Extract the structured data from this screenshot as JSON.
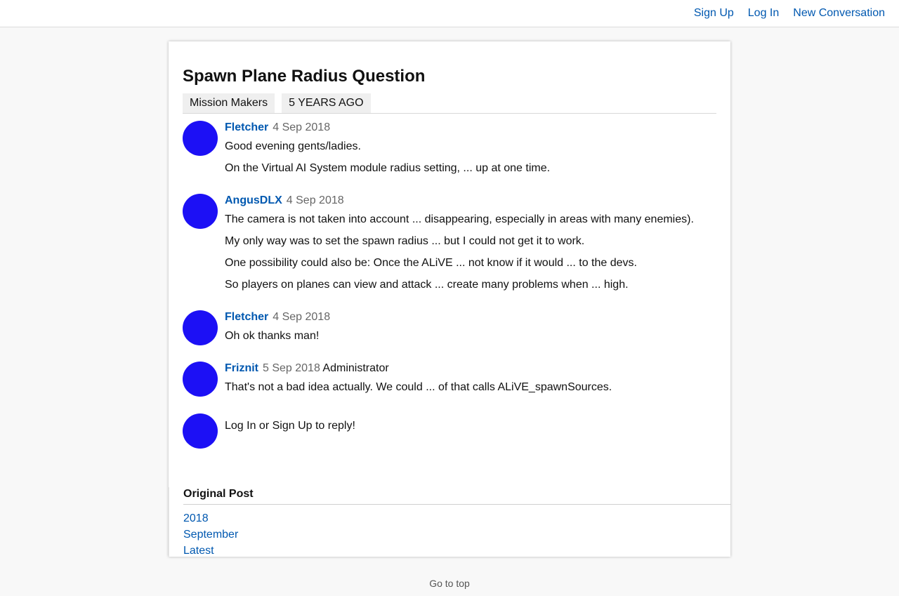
{
  "header": {
    "nav": {
      "sign_up": "Sign Up",
      "log_in": "Log In",
      "new_conversation": "New Conversation"
    }
  },
  "conversation": {
    "title": "Spawn Plane Radius Question",
    "tags": [
      "Mission Makers",
      "5 YEARS AGO"
    ]
  },
  "posts": [
    {
      "author": "Fletcher",
      "date": "4 Sep 2018",
      "role": "",
      "paragraphs": [
        "Good evening gents/ladies.",
        "On the Virtual AI System module radius setting, ... up at one time."
      ]
    },
    {
      "author": "AngusDLX",
      "date": "4 Sep 2018",
      "role": "",
      "paragraphs": [
        "The camera is not taken into account ... disappearing, especially in areas with many enemies).",
        "My only way was to set the spawn radius ... but I could not get it to work.",
        "One possibility could also be: Once the ALiVE ... not know if it would ... to the devs.",
        "So players on planes can view and attack ... create many problems when ... high."
      ]
    },
    {
      "author": "Fletcher",
      "date": "4 Sep 2018",
      "role": "",
      "paragraphs": [
        "Oh ok thanks man!"
      ]
    },
    {
      "author": "Friznit",
      "date": "5 Sep 2018",
      "role": "Administrator",
      "paragraphs": [
        "That's not a bad idea actually. We could ... of that calls ALiVE_spawnSources."
      ]
    }
  ],
  "reply_prompt": "Log In or Sign Up to reply!",
  "sidebar": {
    "heading": "Original Post",
    "links": [
      "2018",
      "September",
      "Latest"
    ]
  },
  "footer": {
    "go_to_top": "Go to top"
  },
  "colors": {
    "link": "#0058b0",
    "avatar": "#1c10f5",
    "background": "#f8f8f8"
  }
}
